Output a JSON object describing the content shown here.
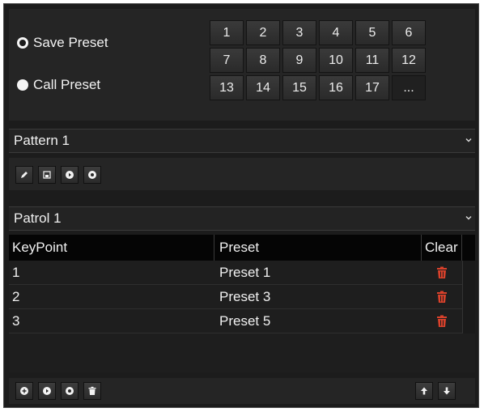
{
  "preset": {
    "save_label": "Save Preset",
    "call_label": "Call Preset",
    "selected": "save",
    "buttons": [
      "1",
      "2",
      "3",
      "4",
      "5",
      "6",
      "7",
      "8",
      "9",
      "10",
      "11",
      "12",
      "13",
      "14",
      "15",
      "16",
      "17",
      "..."
    ]
  },
  "pattern": {
    "selected": "Pattern 1",
    "tool_icons": [
      "edit-icon",
      "save-icon",
      "play-icon",
      "stop-icon"
    ]
  },
  "patrol": {
    "selected": "Patrol 1",
    "columns": [
      "KeyPoint",
      "Preset",
      "Clear"
    ],
    "rows": [
      {
        "keypoint": "1",
        "preset": "Preset 1"
      },
      {
        "keypoint": "2",
        "preset": "Preset 3"
      },
      {
        "keypoint": "3",
        "preset": "Preset 5"
      }
    ],
    "bottom_icons": [
      "add-icon",
      "play-icon",
      "stop-icon",
      "delete-icon",
      "move-up-icon",
      "move-down-icon"
    ]
  },
  "colors": {
    "background": "#1c1c1c",
    "header": "#050505",
    "delete_icon": "#d9412b"
  }
}
